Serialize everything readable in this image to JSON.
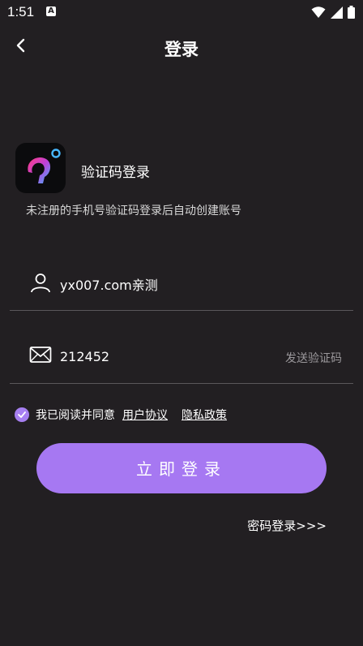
{
  "status_bar": {
    "time": "1:51",
    "app_icon": "A",
    "icons": [
      "wifi-icon",
      "cellular-signal-icon",
      "battery-icon"
    ]
  },
  "header": {
    "title": "登录",
    "back_icon": "chevron-left-icon"
  },
  "intro": {
    "heading": "验证码登录",
    "subtitle": "未注册的手机号验证码登录后自动创建账号"
  },
  "form": {
    "phone": {
      "value": "yx007.com亲测",
      "icon": "user-icon"
    },
    "code": {
      "value": "212452",
      "icon": "mail-icon",
      "send_label": "发送验证码"
    }
  },
  "agreement": {
    "checked": true,
    "text": "我已阅读并同意",
    "link_terms": "用户协议",
    "link_privacy": "隐私政策"
  },
  "login_button": "立即登录",
  "password_login": "密码登录>>>",
  "colors": {
    "background": "#221f22",
    "accent": "#a678f2",
    "divider": "#5a575b",
    "muted": "#9a979b"
  }
}
